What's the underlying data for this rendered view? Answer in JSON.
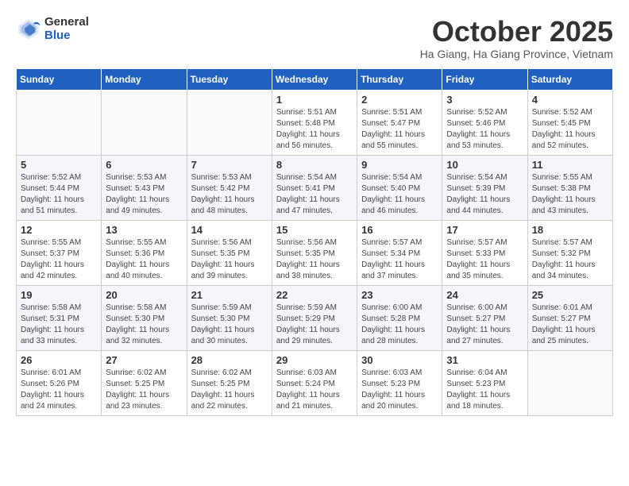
{
  "logo": {
    "general": "General",
    "blue": "Blue"
  },
  "title": {
    "month_year": "October 2025",
    "location": "Ha Giang, Ha Giang Province, Vietnam"
  },
  "days_of_week": [
    "Sunday",
    "Monday",
    "Tuesday",
    "Wednesday",
    "Thursday",
    "Friday",
    "Saturday"
  ],
  "weeks": [
    [
      {
        "day": "",
        "info": ""
      },
      {
        "day": "",
        "info": ""
      },
      {
        "day": "",
        "info": ""
      },
      {
        "day": "1",
        "info": "Sunrise: 5:51 AM\nSunset: 5:48 PM\nDaylight: 11 hours and 56 minutes."
      },
      {
        "day": "2",
        "info": "Sunrise: 5:51 AM\nSunset: 5:47 PM\nDaylight: 11 hours and 55 minutes."
      },
      {
        "day": "3",
        "info": "Sunrise: 5:52 AM\nSunset: 5:46 PM\nDaylight: 11 hours and 53 minutes."
      },
      {
        "day": "4",
        "info": "Sunrise: 5:52 AM\nSunset: 5:45 PM\nDaylight: 11 hours and 52 minutes."
      }
    ],
    [
      {
        "day": "5",
        "info": "Sunrise: 5:52 AM\nSunset: 5:44 PM\nDaylight: 11 hours and 51 minutes."
      },
      {
        "day": "6",
        "info": "Sunrise: 5:53 AM\nSunset: 5:43 PM\nDaylight: 11 hours and 49 minutes."
      },
      {
        "day": "7",
        "info": "Sunrise: 5:53 AM\nSunset: 5:42 PM\nDaylight: 11 hours and 48 minutes."
      },
      {
        "day": "8",
        "info": "Sunrise: 5:54 AM\nSunset: 5:41 PM\nDaylight: 11 hours and 47 minutes."
      },
      {
        "day": "9",
        "info": "Sunrise: 5:54 AM\nSunset: 5:40 PM\nDaylight: 11 hours and 46 minutes."
      },
      {
        "day": "10",
        "info": "Sunrise: 5:54 AM\nSunset: 5:39 PM\nDaylight: 11 hours and 44 minutes."
      },
      {
        "day": "11",
        "info": "Sunrise: 5:55 AM\nSunset: 5:38 PM\nDaylight: 11 hours and 43 minutes."
      }
    ],
    [
      {
        "day": "12",
        "info": "Sunrise: 5:55 AM\nSunset: 5:37 PM\nDaylight: 11 hours and 42 minutes."
      },
      {
        "day": "13",
        "info": "Sunrise: 5:55 AM\nSunset: 5:36 PM\nDaylight: 11 hours and 40 minutes."
      },
      {
        "day": "14",
        "info": "Sunrise: 5:56 AM\nSunset: 5:35 PM\nDaylight: 11 hours and 39 minutes."
      },
      {
        "day": "15",
        "info": "Sunrise: 5:56 AM\nSunset: 5:35 PM\nDaylight: 11 hours and 38 minutes."
      },
      {
        "day": "16",
        "info": "Sunrise: 5:57 AM\nSunset: 5:34 PM\nDaylight: 11 hours and 37 minutes."
      },
      {
        "day": "17",
        "info": "Sunrise: 5:57 AM\nSunset: 5:33 PM\nDaylight: 11 hours and 35 minutes."
      },
      {
        "day": "18",
        "info": "Sunrise: 5:57 AM\nSunset: 5:32 PM\nDaylight: 11 hours and 34 minutes."
      }
    ],
    [
      {
        "day": "19",
        "info": "Sunrise: 5:58 AM\nSunset: 5:31 PM\nDaylight: 11 hours and 33 minutes."
      },
      {
        "day": "20",
        "info": "Sunrise: 5:58 AM\nSunset: 5:30 PM\nDaylight: 11 hours and 32 minutes."
      },
      {
        "day": "21",
        "info": "Sunrise: 5:59 AM\nSunset: 5:30 PM\nDaylight: 11 hours and 30 minutes."
      },
      {
        "day": "22",
        "info": "Sunrise: 5:59 AM\nSunset: 5:29 PM\nDaylight: 11 hours and 29 minutes."
      },
      {
        "day": "23",
        "info": "Sunrise: 6:00 AM\nSunset: 5:28 PM\nDaylight: 11 hours and 28 minutes."
      },
      {
        "day": "24",
        "info": "Sunrise: 6:00 AM\nSunset: 5:27 PM\nDaylight: 11 hours and 27 minutes."
      },
      {
        "day": "25",
        "info": "Sunrise: 6:01 AM\nSunset: 5:27 PM\nDaylight: 11 hours and 25 minutes."
      }
    ],
    [
      {
        "day": "26",
        "info": "Sunrise: 6:01 AM\nSunset: 5:26 PM\nDaylight: 11 hours and 24 minutes."
      },
      {
        "day": "27",
        "info": "Sunrise: 6:02 AM\nSunset: 5:25 PM\nDaylight: 11 hours and 23 minutes."
      },
      {
        "day": "28",
        "info": "Sunrise: 6:02 AM\nSunset: 5:25 PM\nDaylight: 11 hours and 22 minutes."
      },
      {
        "day": "29",
        "info": "Sunrise: 6:03 AM\nSunset: 5:24 PM\nDaylight: 11 hours and 21 minutes."
      },
      {
        "day": "30",
        "info": "Sunrise: 6:03 AM\nSunset: 5:23 PM\nDaylight: 11 hours and 20 minutes."
      },
      {
        "day": "31",
        "info": "Sunrise: 6:04 AM\nSunset: 5:23 PM\nDaylight: 11 hours and 18 minutes."
      },
      {
        "day": "",
        "info": ""
      }
    ]
  ]
}
